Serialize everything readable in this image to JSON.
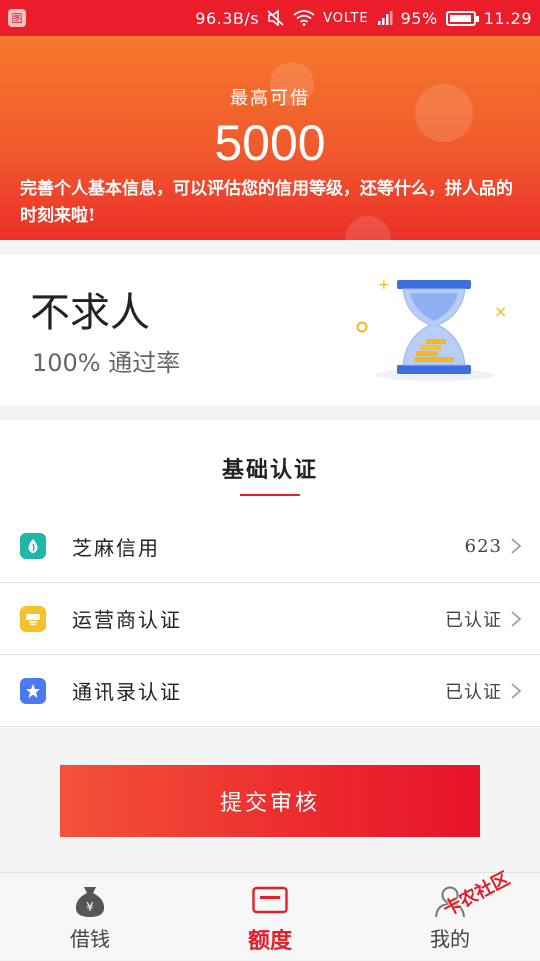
{
  "status_bar": {
    "app_icon": "图",
    "speed": "96.3B/s",
    "network": "VOLTE",
    "battery": "95%",
    "battery_level": 0.95,
    "time": "11.29"
  },
  "hero": {
    "label": "最高可借",
    "amount": "5000",
    "description": "完善个人基本信息，可以评估您的信用等级，还等什么，拼人品的时刻来啦!"
  },
  "promo": {
    "title": "不求人",
    "subtitle": "100% 通过率",
    "illustration": "hourglass-icon"
  },
  "section": {
    "title": "基础认证",
    "accent_color": "#e61e2a",
    "items": [
      {
        "label": "芝麻信用",
        "value": "623",
        "icon": "sesame-icon",
        "icon_color": "#20b6a8"
      },
      {
        "label": "运营商认证",
        "value": "已认证",
        "icon": "carrier-icon",
        "icon_color": "#f6c22c"
      },
      {
        "label": "通讯录认证",
        "value": "已认证",
        "icon": "contacts-star-icon",
        "icon_color": "#4a79f0"
      }
    ]
  },
  "submit_label": "提交审核",
  "tabs": [
    {
      "label": "借钱",
      "icon": "money-bag-icon",
      "active": false
    },
    {
      "label": "额度",
      "icon": "card-icon",
      "active": true
    },
    {
      "label": "我的",
      "icon": "person-icon",
      "active": false
    }
  ],
  "watermark": "卡农社区",
  "colors": {
    "brand_red": "#ec1d2a",
    "hero_orange": "#f5792b"
  }
}
